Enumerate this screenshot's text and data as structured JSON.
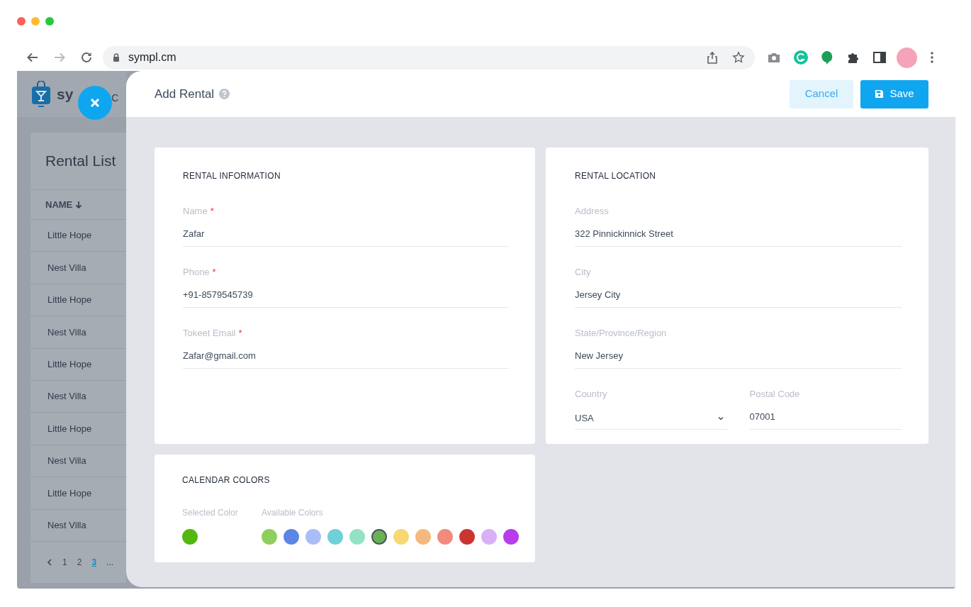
{
  "browser": {
    "url": "sympl.cm"
  },
  "background_app": {
    "logo_text": "sy",
    "nav_text": "C",
    "list_title": "Rental List",
    "column": "NAME",
    "rows": [
      "Little Hope",
      "Nest Villa",
      "Little Hope",
      "Nest Villa",
      "Little Hope",
      "Nest Villa",
      "Little Hope",
      "Nest Villa",
      "Little Hope",
      "Nest Villa"
    ],
    "pagination": [
      {
        "label": "1",
        "selected": false
      },
      {
        "label": "2",
        "selected": false
      },
      {
        "label": "3",
        "selected": true
      },
      {
        "label": "...",
        "selected": false
      }
    ]
  },
  "modal": {
    "title": "Add Rental",
    "cancel": "Cancel",
    "save": "Save",
    "info": {
      "heading": "RENTAL INFORMATION",
      "fields": [
        {
          "label": "Name",
          "required_mark": "*",
          "value": "Zafar",
          "kind": "text"
        },
        {
          "label": "Phone",
          "required_mark": "*",
          "value": "+91-8579545739",
          "kind": "text"
        },
        {
          "label": "Tokeet Email",
          "required_mark": "*",
          "value": "Zafar@gmail.com",
          "kind": "text"
        }
      ]
    },
    "location": {
      "heading": "RENTAL LOCATION",
      "rows": [
        [
          {
            "label": "Address",
            "value": "322  Pinnickinnick Street",
            "kind": "text"
          }
        ],
        [
          {
            "label": "City",
            "value": "Jersey City",
            "kind": "text"
          }
        ],
        [
          {
            "label": "State/Province/Region",
            "value": "New Jersey",
            "kind": "text"
          }
        ],
        [
          {
            "label": "Country",
            "value": "USA",
            "kind": "select"
          },
          {
            "label": "Postal Code",
            "value": "07001",
            "kind": "text"
          }
        ]
      ]
    },
    "colors": {
      "heading": "CALENDAR COLORS",
      "selected_label": "Selected Color",
      "available_label": "Available Colors",
      "selected_swatches": [
        {
          "color": "#52b80f"
        }
      ],
      "available": [
        {
          "color": "#8fce5d",
          "selected": false
        },
        {
          "color": "#5b86e5",
          "selected": false
        },
        {
          "color": "#a9bdf7",
          "selected": false
        },
        {
          "color": "#6fd0d8",
          "selected": false
        },
        {
          "color": "#93e2c4",
          "selected": false
        },
        {
          "color": "#6ab154",
          "selected": true
        },
        {
          "color": "#f8d775",
          "selected": false
        },
        {
          "color": "#f5b97f",
          "selected": false
        },
        {
          "color": "#f28b7d",
          "selected": false
        },
        {
          "color": "#cc3430",
          "selected": false
        },
        {
          "color": "#d9b0f8",
          "selected": false
        },
        {
          "color": "#b83ceb",
          "selected": false
        }
      ]
    }
  }
}
